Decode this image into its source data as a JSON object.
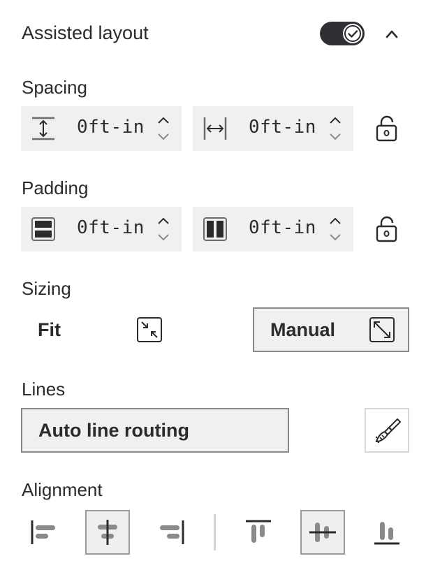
{
  "header": {
    "title": "Assisted layout",
    "toggle_on": true
  },
  "spacing": {
    "label": "Spacing",
    "vertical_value": "0ft-in",
    "horizontal_value": "0ft-in"
  },
  "padding": {
    "label": "Padding",
    "vertical_value": "0ft-in",
    "horizontal_value": "0ft-in"
  },
  "sizing": {
    "label": "Sizing",
    "fit_label": "Fit",
    "manual_label": "Manual",
    "selected": "Manual"
  },
  "lines": {
    "label": "Lines",
    "routing_label": "Auto line routing"
  },
  "alignment": {
    "label": "Alignment",
    "horizontal_selected": "center",
    "vertical_selected": "middle"
  },
  "colors": {
    "accent": "#2f3033",
    "field_bg": "#f0f0f0",
    "border": "#8a8a8a"
  }
}
